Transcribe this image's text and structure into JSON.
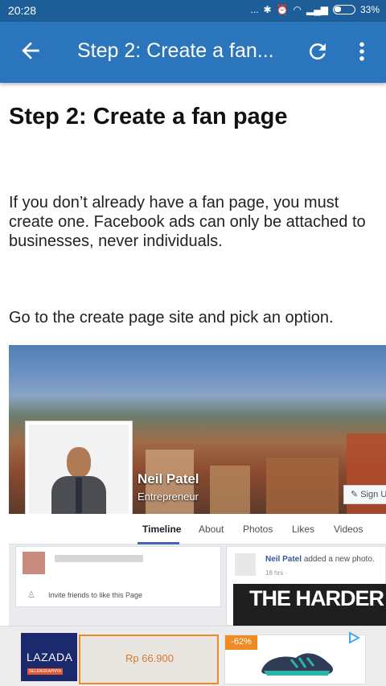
{
  "status_bar": {
    "time": "20:28",
    "indicators": "...",
    "battery": "33%"
  },
  "app_bar": {
    "back_icon": "arrow-left-icon",
    "title": "Step 2: Create a fan...",
    "refresh_icon": "refresh-icon",
    "more_icon": "more-vert-icon",
    "color": "#2a75bb"
  },
  "article": {
    "heading": "Step 2: Create a fan page",
    "paragraph1": "If you don’t already have a fan page, you must create one. Facebook ads can only be attached to businesses, never individuals.",
    "paragraph2": "Go to the create page site and pick an option."
  },
  "screenshot": {
    "name": "Neil Patel",
    "role": "Entrepreneur",
    "sign_button": "Sign U",
    "tabs": [
      "Timeline",
      "About",
      "Photos",
      "Likes",
      "Videos"
    ],
    "invite": "Invite friends to like this Page",
    "post_author": "Neil Patel",
    "post_action": "added a new photo.",
    "post_time": "18 hrs · ",
    "banner": "THE HARDER"
  },
  "ad": {
    "brand": "LAZADA",
    "brand_sub": "SELENGKAPNYA",
    "price": "Rp 66.900",
    "discount": "-62%"
  }
}
